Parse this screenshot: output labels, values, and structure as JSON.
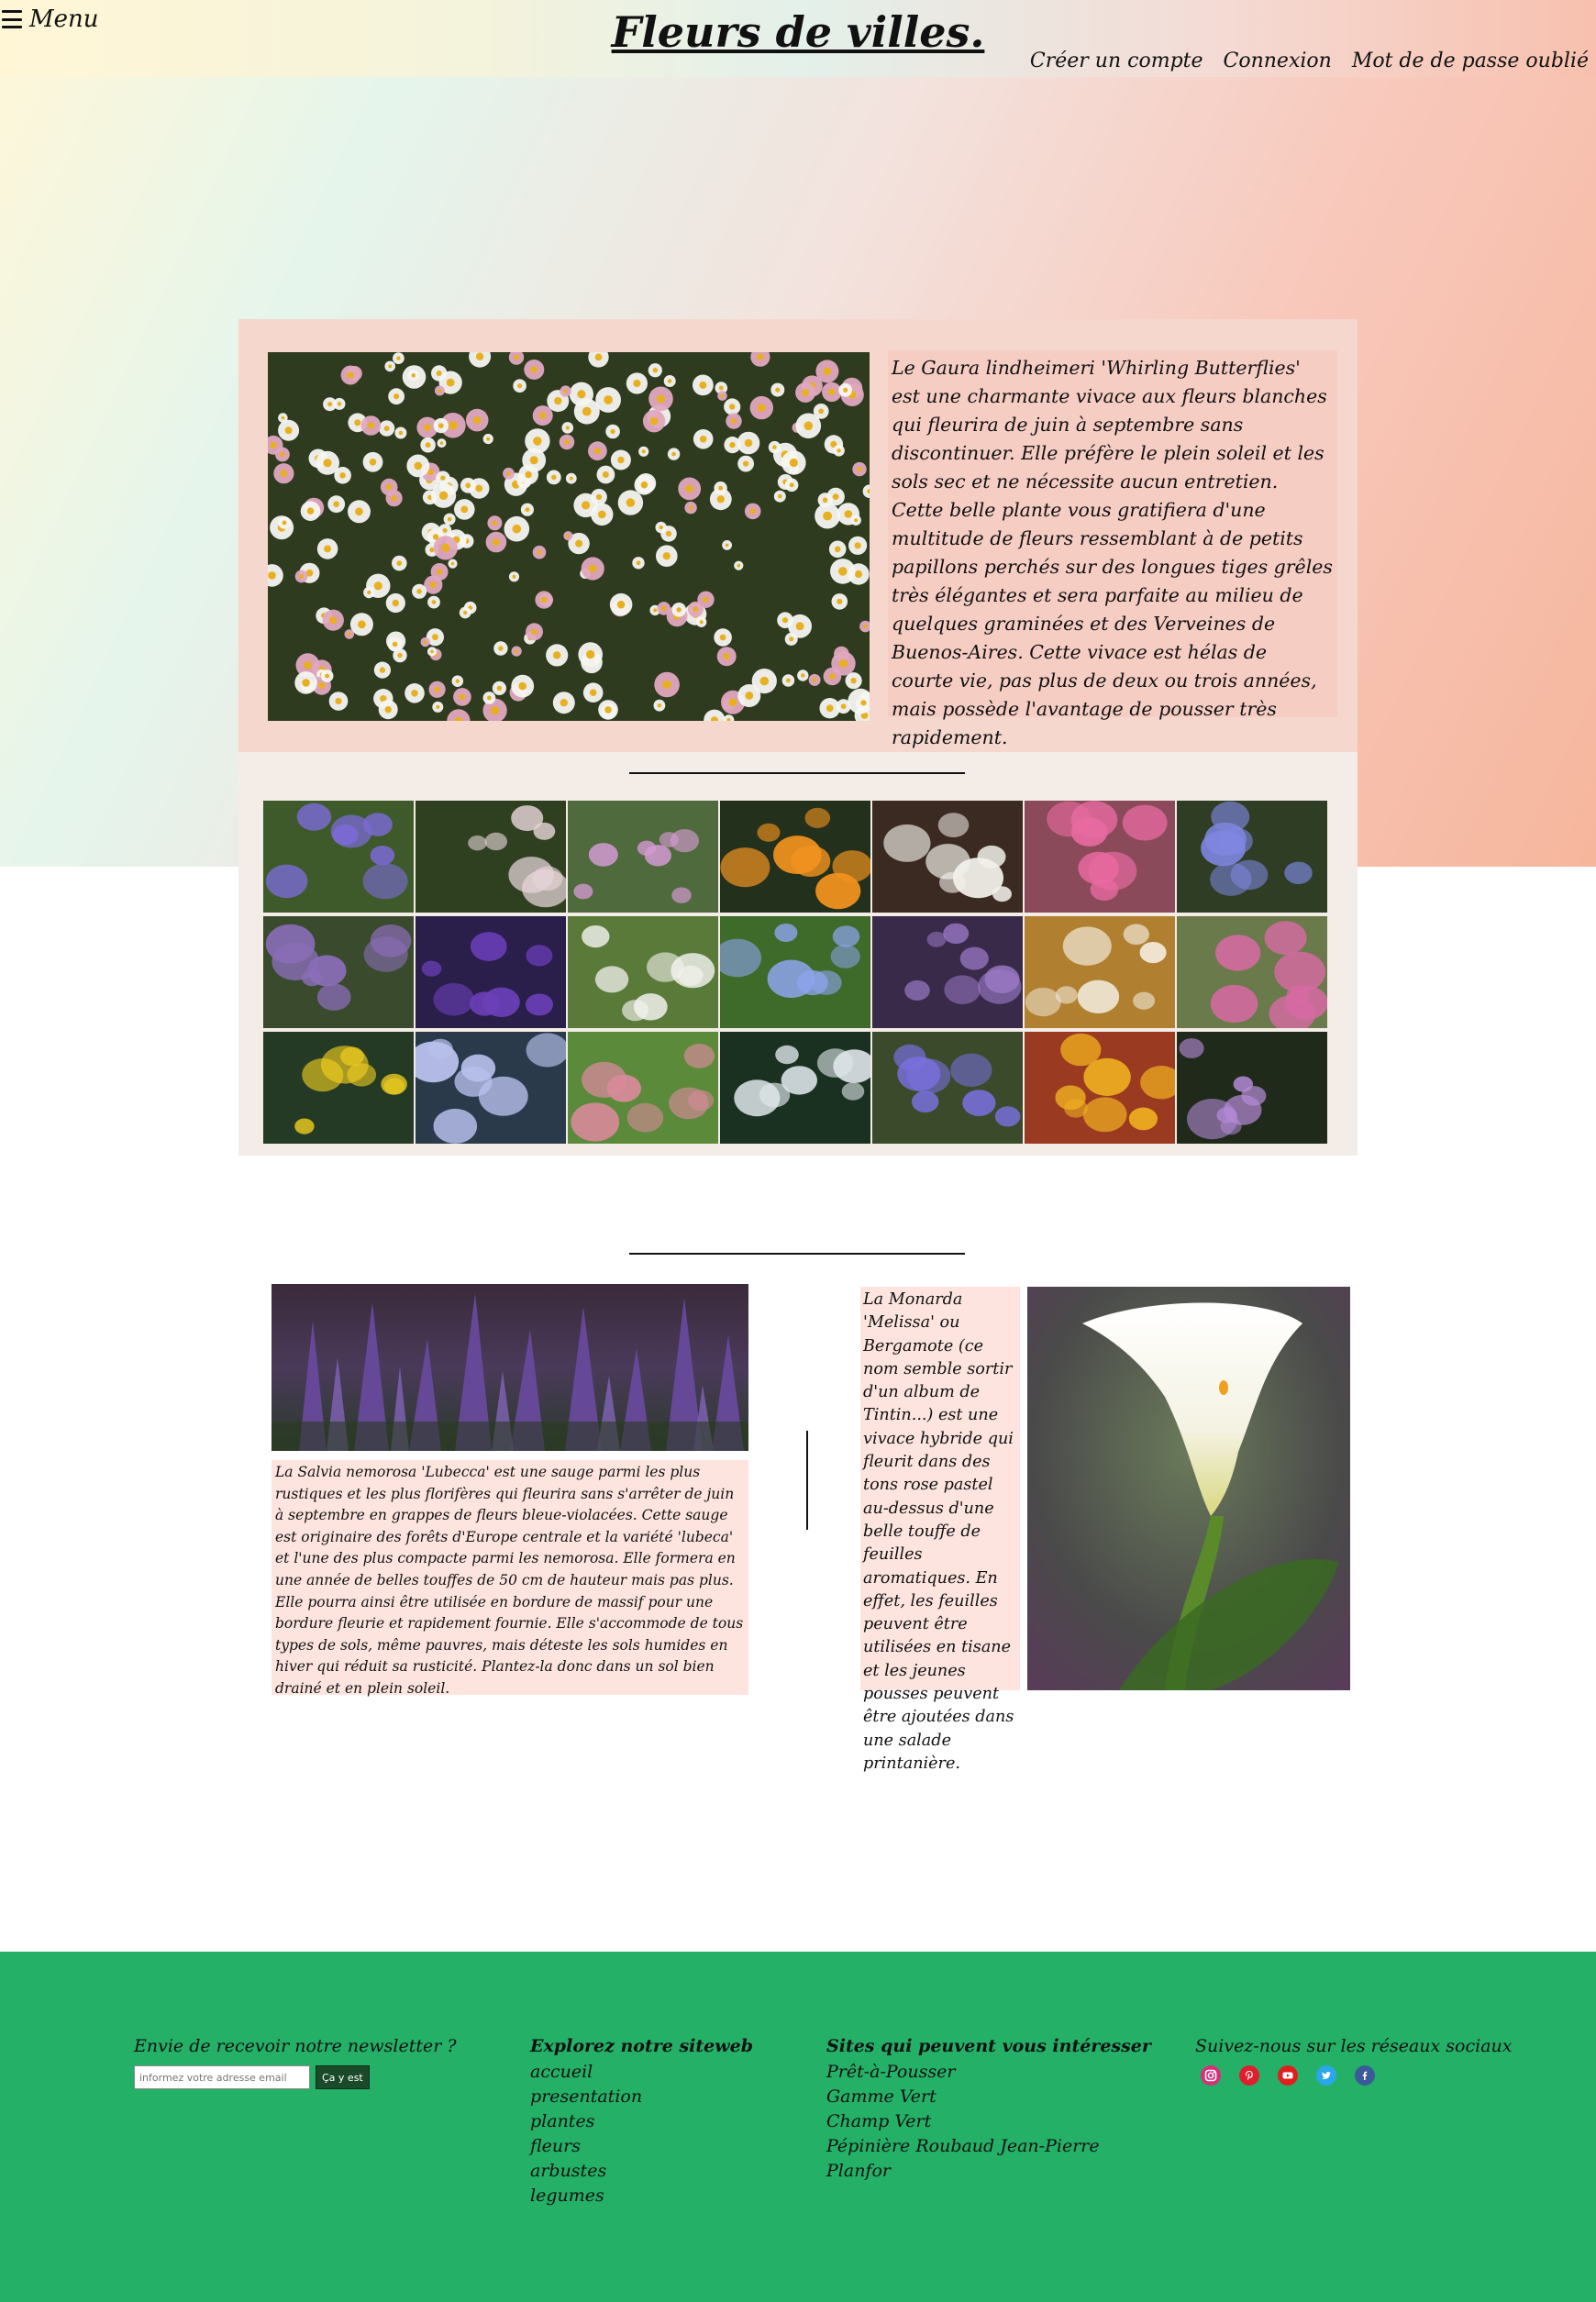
{
  "header": {
    "menu_label": "Menu",
    "site_title": "Fleurs de villes.",
    "links": [
      "Créer un compte",
      "Connexion",
      "Mot de de passe oublié"
    ]
  },
  "featured": {
    "image_alt": "Massif de fleurs blanches et roses (érigeron)",
    "text": "Le Gaura lindheimeri 'Whirling Butterflies' est une charmante vivace aux fleurs blanches qui fleurira de juin à septembre sans discontinuer. Elle préfère le plein soleil et les sols sec et ne nécessite aucun entretien. Cette belle plante vous gratifiera d'une multitude de fleurs ressemblant à de petits papillons perchés sur des longues tiges grêles très élégantes et sera parfaite au milieu de quelques graminées et des Verveines de Buenos-Aires. Cette vivace est hélas de courte vie, pas plus de deux ou trois années, mais possède l'avantage de pousser très rapidement."
  },
  "gallery": {
    "thumbs": [
      {
        "name": "lupins",
        "bg": "#3f5a2a",
        "accent": "#7b6ad6"
      },
      {
        "name": "astrance",
        "bg": "#2f4020",
        "accent": "#e8d6da"
      },
      {
        "name": "orchidee",
        "bg": "#4f6a3c",
        "accent": "#d79bd6"
      },
      {
        "name": "lys-orange",
        "bg": "#23301c",
        "accent": "#f0921f"
      },
      {
        "name": "cyclamen-blanc",
        "bg": "#3b2a22",
        "accent": "#f2f0ea"
      },
      {
        "name": "aster-rose",
        "bg": "#8b4a5a",
        "accent": "#e86aa0"
      },
      {
        "name": "agapanthe",
        "bg": "#2e3d24",
        "accent": "#7e86e0"
      },
      {
        "name": "buglosse",
        "bg": "#3a4a2c",
        "accent": "#8a6eb8"
      },
      {
        "name": "clematite",
        "bg": "#2a1f4a",
        "accent": "#6b3fb8"
      },
      {
        "name": "dahlia-blanc",
        "bg": "#5a7a3a",
        "accent": "#f4f4f0"
      },
      {
        "name": "agapanthe-bleue",
        "bg": "#3e6a2a",
        "accent": "#8ea4ec"
      },
      {
        "name": "hortensia",
        "bg": "#3a2a4a",
        "accent": "#9a7ac6"
      },
      {
        "name": "mauve",
        "bg": "#b08030",
        "accent": "#f2e8d8"
      },
      {
        "name": "pensee-sauvage",
        "bg": "#6a7a4a",
        "accent": "#d86aa4"
      },
      {
        "name": "chelidoine",
        "bg": "#243a24",
        "accent": "#f2d020"
      },
      {
        "name": "aconit",
        "bg": "#2a3a4a",
        "accent": "#b8c0ec"
      },
      {
        "name": "renouee",
        "bg": "#5a8a3a",
        "accent": "#d88a9a"
      },
      {
        "name": "achillee",
        "bg": "#1a3020",
        "accent": "#dfe6ea"
      },
      {
        "name": "campanule",
        "bg": "#3a4a2a",
        "accent": "#7a70e0"
      },
      {
        "name": "freesia",
        "bg": "#9a3a20",
        "accent": "#f0b020"
      },
      {
        "name": "hosta",
        "bg": "#1f2a1a",
        "accent": "#b48ad6"
      }
    ]
  },
  "article1": {
    "image_alt": "Sauge violette (Salvia nemorosa)",
    "text": "La Salvia nemorosa 'Lubecca' est une sauge parmi les plus rustiques et les plus florifères qui fleurira sans s'arrêter de juin à septembre en grappes de fleurs bleue-violacées. Cette sauge est originaire des forêts d'Europe centrale et la variété 'lubeca' et l'une des plus compacte parmi les nemorosa. Elle formera en une année de belles touffes de 50 cm de hauteur mais pas plus. Elle pourra ainsi être utilisée en bordure de massif pour une bordure fleurie et rapidement fournie. Elle s'accommode de tous types de sols, même pauvres, mais déteste les sols humides en hiver qui réduit sa rusticité. Plantez-la donc dans un sol bien drainé et en plein soleil."
  },
  "article2": {
    "image_alt": "Arum blanc (Zantedeschia)",
    "text": "La Monarda 'Melissa' ou Bergamote (ce nom semble sortir d'un album de Tintin...) est une vivace hybride qui fleurit dans des tons rose pastel au-dessus d'une belle touffe de feuilles aromatiques. En effet, les feuilles peuvent être utilisées en tisane et les jeunes pousses peuvent être ajoutées dans une salade printanière."
  },
  "footer": {
    "newsletter": {
      "heading": "Envie de recevoir notre newsletter ?",
      "placeholder": "informez votre adresse email",
      "button": "Ça y est"
    },
    "explore": {
      "heading": "Explorez notre siteweb",
      "links": [
        "accueil",
        "presentation",
        "plantes",
        "fleurs",
        "arbustes",
        "legumes"
      ]
    },
    "sites": {
      "heading": "Sites qui peuvent vous intéresser",
      "links": [
        "Prêt-à-Pousser",
        "Gamme Vert",
        "Champ Vert",
        "Pépinière Roubaud Jean-Pierre",
        "Planfor"
      ]
    },
    "social": {
      "heading": "Suivez-nous sur les réseaux sociaux",
      "icons": [
        {
          "name": "instagram-icon",
          "color": "#d6307a"
        },
        {
          "name": "pinterest-icon",
          "color": "#e01e2e"
        },
        {
          "name": "youtube-icon",
          "color": "#e01e1e"
        },
        {
          "name": "twitter-icon",
          "color": "#2aa6ec"
        },
        {
          "name": "facebook-icon",
          "color": "#3b5a9a"
        }
      ]
    }
  }
}
